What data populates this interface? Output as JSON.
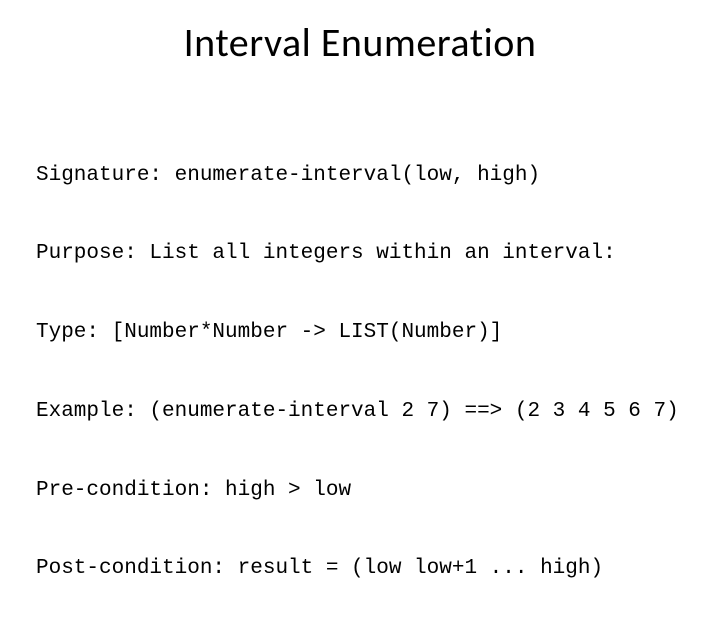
{
  "title": "Interval Enumeration",
  "lines": {
    "signature": "Signature: enumerate-interval(low, high)",
    "purpose": "Purpose: List all integers within an interval:",
    "type": "Type: [Number*Number -> LIST(Number)]",
    "example": "Example: (enumerate-interval 2 7) ==> (2 3 4 5 6 7)",
    "precondition": "Pre-condition: high > low",
    "postcondition": "Post-condition: result = (low low+1 ... high)"
  }
}
